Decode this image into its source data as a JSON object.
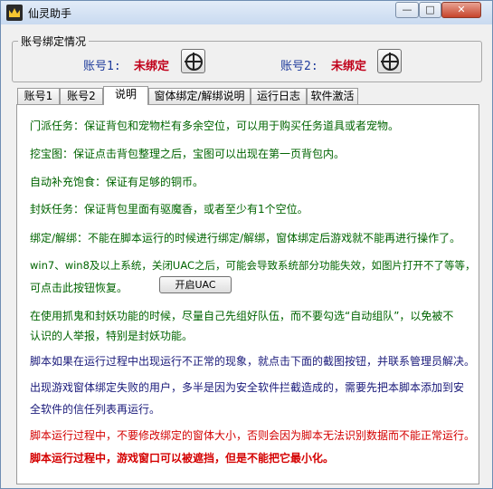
{
  "window": {
    "title": "仙灵助手",
    "controls": {
      "minimize": "—",
      "maximize": "□",
      "close": "✕"
    }
  },
  "accounts": {
    "group_title": "账号绑定情况",
    "account1": {
      "label": "账号1:",
      "status": "未绑定"
    },
    "account2": {
      "label": "账号2:",
      "status": "未绑定"
    }
  },
  "tabs": [
    {
      "label": "账号1"
    },
    {
      "label": "账号2"
    },
    {
      "label": "说明"
    },
    {
      "label": "窗体绑定/解绑说明"
    },
    {
      "label": "运行日志"
    },
    {
      "label": "软件激活"
    }
  ],
  "active_tab": "说明",
  "instructions": {
    "l1": "门派任务：保证背包和宠物栏有多余空位，可以用于购买任务道具或者宠物。",
    "l2": "挖宝图：保证点击背包整理之后，宝图可以出现在第一页背包内。",
    "l3": "自动补充饱食：保证有足够的铜币。",
    "l4": "封妖任务：保证背包里面有驱魔香，或者至少有1个空位。",
    "l5": "绑定/解绑：不能在脚本运行的时候进行绑定/解绑，窗体绑定后游戏就不能再进行操作了。",
    "l6": "win7、win8及以上系统，关闭UAC之后，可能会导致系统部分功能失效，如图片打开不了等等，",
    "l7": "可点击此按钮恢复。",
    "uac_button": "开启UAC",
    "l8": "在使用抓鬼和封妖功能的时候，尽量自己先组好队伍，而不要勾选“自动组队”，以免被不",
    "l9": "认识的人举报，特别是封妖功能。",
    "l10": "脚本如果在运行过程中出现运行不正常的现象，就点击下面的截图按钮，并联系管理员解决。",
    "l11": "出现游戏窗体绑定失败的用户，多半是因为安全软件拦截造成的，需要先把本脚本添加到安",
    "l12": "全软件的信任列表再运行。",
    "l13": "脚本运行过程中，不要修改绑定的窗体大小，否则会因为脚本无法识别数据而不能正常运行。",
    "l14": "脚本运行过程中，游戏窗口可以被遮挡，但是不能把它最小化。"
  },
  "colors": {
    "green_text": "#006400",
    "navy_text": "#1a1a7a",
    "red_text": "#d40000",
    "status_red": "#c0001a",
    "account_label_blue": "#1f3c9c"
  }
}
